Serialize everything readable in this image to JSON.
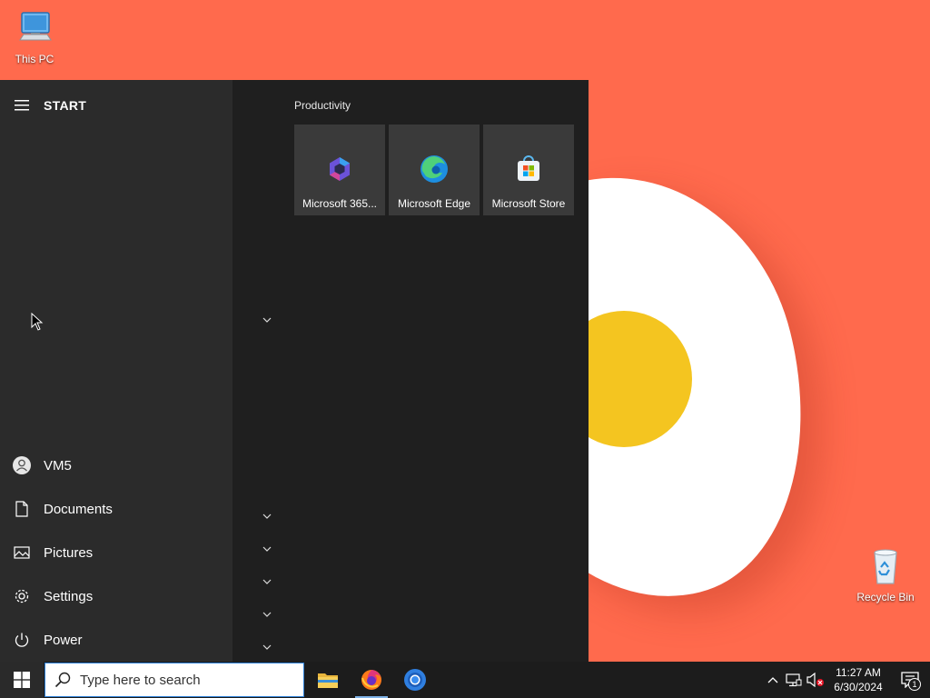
{
  "desktop": {
    "icons": [
      {
        "label": "This PC",
        "icon": "computer-icon"
      },
      {
        "label": "Recycle Bin",
        "icon": "recycle-bin-icon"
      }
    ]
  },
  "start_menu": {
    "title": "START",
    "nav": [
      {
        "label": "VM5",
        "icon": "user-avatar-icon"
      },
      {
        "label": "Documents",
        "icon": "document-icon"
      },
      {
        "label": "Pictures",
        "icon": "pictures-icon"
      },
      {
        "label": "Settings",
        "icon": "gear-icon"
      },
      {
        "label": "Power",
        "icon": "power-icon"
      }
    ],
    "group_title": "Productivity",
    "tiles": [
      {
        "label": "Microsoft 365...",
        "icon": "microsoft-365-icon"
      },
      {
        "label": "Microsoft Edge",
        "icon": "edge-icon"
      },
      {
        "label": "Microsoft Store",
        "icon": "store-icon"
      }
    ]
  },
  "taskbar": {
    "search_placeholder": "Type here to search",
    "apps": [
      {
        "name": "File Explorer",
        "icon": "folder-icon"
      },
      {
        "name": "Firefox",
        "icon": "firefox-icon"
      },
      {
        "name": "Chrome",
        "icon": "chrome-icon"
      }
    ],
    "time": "11:27 AM",
    "date": "6/30/2024",
    "notification_count": "1"
  },
  "colors": {
    "wallpaper": "#ff6a4d",
    "start_bg": "#1f1f1f",
    "tile_bg": "#3a3a3a",
    "accent": "#2d7fd6"
  }
}
